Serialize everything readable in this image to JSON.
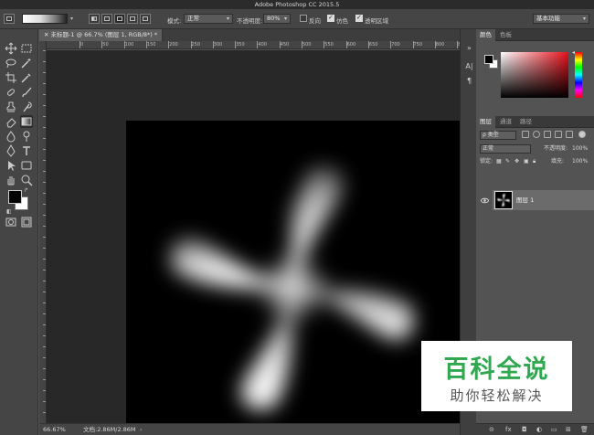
{
  "window": {
    "title": "Adobe Photoshop CC 2015.5"
  },
  "options_bar": {
    "mode_label": "模式:",
    "mode_value": "正常",
    "opacity_label": "不透明度:",
    "opacity_value": "80%",
    "reverse_label": "反向",
    "reverse_checked": false,
    "dither_label": "仿色",
    "dither_checked": true,
    "transparency_label": "透明区域",
    "transparency_checked": true,
    "workspace_value": "基本功能"
  },
  "document": {
    "tab_title": "未标题-1 @ 66.7% (图层 1, RGB/8*) *",
    "ruler_ticks": [
      "0",
      "50",
      "100",
      "150",
      "200",
      "250",
      "300",
      "350",
      "400",
      "450",
      "500",
      "550",
      "600",
      "650",
      "700",
      "750",
      "800",
      "850",
      "900",
      "950"
    ]
  },
  "status_bar": {
    "zoom": "66.67%",
    "doc_info": "文档:2.86M/2.86M"
  },
  "color_panel": {
    "tabs": [
      "颜色",
      "色板"
    ],
    "active_tab": "颜色"
  },
  "layers_panel": {
    "tabs": [
      "图层",
      "通道",
      "路径"
    ],
    "active_tab": "图层",
    "filter_label": "ρ 类型",
    "blend_mode": "正常",
    "opacity_label": "不透明度:",
    "opacity_value": "100%",
    "lock_label": "锁定:",
    "fill_label": "填充:",
    "fill_value": "100%",
    "layers": [
      {
        "name": "图层 1",
        "visible": true,
        "selected": true
      }
    ]
  },
  "watermark": {
    "title": "百科全说",
    "subtitle": "助你轻松解决"
  },
  "colors": {
    "accent_green": "#2fa84f",
    "panel_bg": "#535353",
    "canvas_bg": "#000000"
  }
}
